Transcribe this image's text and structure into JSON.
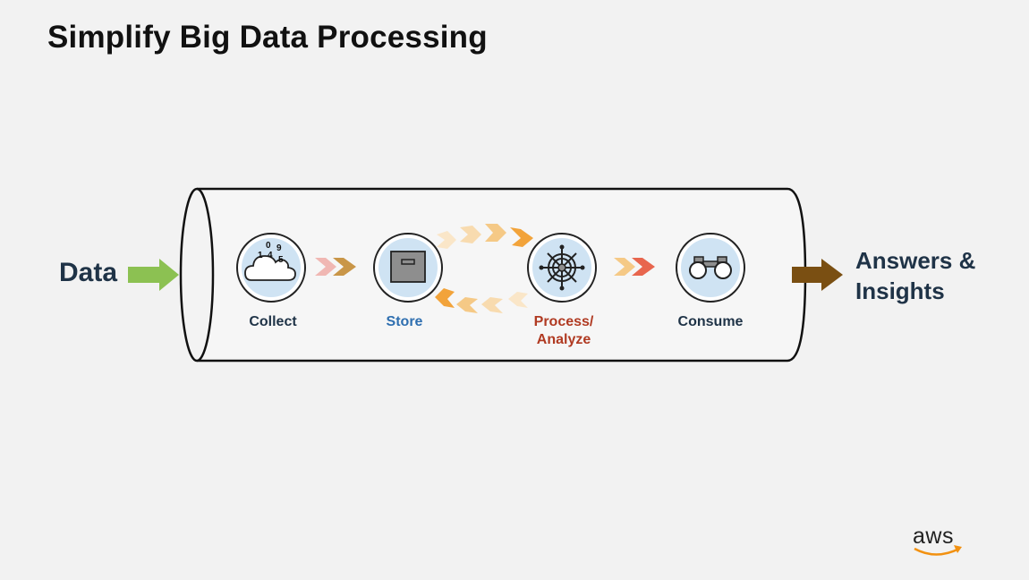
{
  "slide": {
    "title": "Simplify Big Data Processing"
  },
  "flow": {
    "input_label": "Data",
    "output_label_line1": "Answers &",
    "output_label_line2": "Insights",
    "stages": [
      {
        "label": "Collect",
        "icon": "cloud-data-icon"
      },
      {
        "label": "Store",
        "icon": "storage-box-icon"
      },
      {
        "label": "Process/",
        "label_line2": "Analyze",
        "icon": "ship-wheel-icon"
      },
      {
        "label": "Consume",
        "icon": "binoculars-icon"
      }
    ],
    "collect_digits": [
      "0",
      "9",
      "1",
      "4",
      "5"
    ]
  },
  "colors": {
    "input_arrow": "#8cc152",
    "output_arrow": "#7a4f12",
    "icon_fill": "#cfe3f3",
    "store_label": "#2f6fb0",
    "process_label": "#b03a22",
    "dark_label": "#1f3347",
    "loop_arrow": "#f2a33a"
  },
  "branding": {
    "logo_text": "aws"
  }
}
